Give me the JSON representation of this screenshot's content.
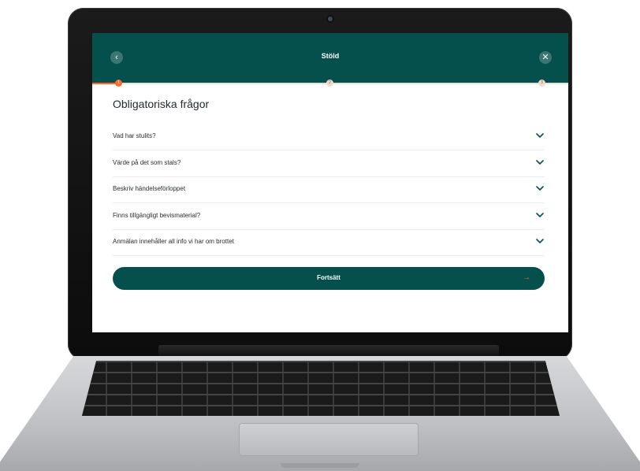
{
  "header": {
    "title": "Stöld",
    "back_icon": "‹",
    "close_icon": "✕"
  },
  "progress": {
    "steps": [
      "1",
      "2",
      "3"
    ],
    "current_step": 1,
    "fill_fraction": 0.06,
    "accent": "#ff6a2c"
  },
  "main": {
    "heading": "Obligatoriska frågor",
    "questions": [
      {
        "label": "Vad har stulits?"
      },
      {
        "label": "Värde på det som stals?"
      },
      {
        "label": "Beskriv händelseförloppet"
      },
      {
        "label": "Finns tillgängligt bevismaterial?"
      },
      {
        "label": "Anmälan innehåller all info vi har om brottet"
      }
    ],
    "continue_label": "Fortsätt",
    "continue_icon": "→"
  },
  "theme": {
    "primary": "#05504c"
  }
}
